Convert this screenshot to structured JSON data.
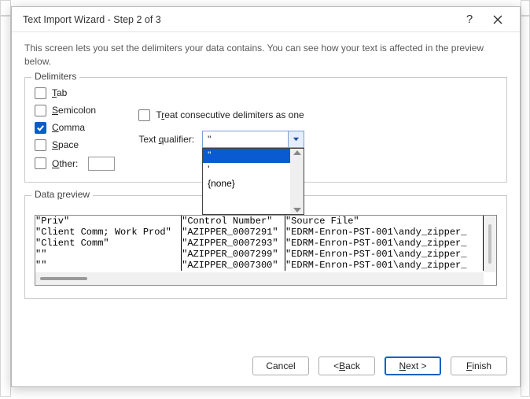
{
  "window": {
    "title": "Text Import Wizard - Step 2 of 3"
  },
  "description": "This screen lets you set the delimiters your data contains.  You can see how your text is affected in the preview below.",
  "delimiters": {
    "legend": "Delimiters",
    "tab": {
      "mnem": "T",
      "rest": "ab",
      "checked": false
    },
    "semicolon": {
      "mnem": "S",
      "rest": "emicolon",
      "checked": false
    },
    "comma": {
      "mnem": "C",
      "rest": "omma",
      "checked": true
    },
    "space": {
      "mnem": "S",
      "rest": "pace",
      "checked": false
    },
    "other": {
      "mnem": "O",
      "rest": "ther:",
      "checked": false,
      "value": ""
    }
  },
  "consecutive": {
    "pre": "T",
    "mnem": "r",
    "rest": "eat consecutive delimiters as one",
    "checked": false
  },
  "qualifier": {
    "label_pre": "Text ",
    "label_mnem": "q",
    "label_rest": "ualifier:",
    "value": "\"",
    "options": [
      "\"",
      "'",
      "{none}"
    ],
    "selected_index": 0
  },
  "preview": {
    "legend_pre": "Data ",
    "legend_mnem": "p",
    "legend_rest": "review",
    "rows": [
      [
        "\"Priv\"",
        "\"Control Number\"",
        "\"Source File\""
      ],
      [
        "\"Client Comm; Work Prod\"",
        "\"AZIPPER_0007291\"",
        "\"EDRM-Enron-PST-001\\andy_zipper_"
      ],
      [
        "\"Client Comm\"",
        "\"AZIPPER_0007293\"",
        "\"EDRM-Enron-PST-001\\andy_zipper_"
      ],
      [
        "\"\"",
        "\"AZIPPER_0007299\"",
        "\"EDRM-Enron-PST-001\\andy_zipper_"
      ],
      [
        "\"\"",
        "\"AZIPPER_0007300\"",
        "\"EDRM-Enron-PST-001\\andy_zipper_"
      ]
    ]
  },
  "buttons": {
    "cancel": "Cancel",
    "back_pre": "< ",
    "back_mnem": "B",
    "back_rest": "ack",
    "next_mnem": "N",
    "next_rest": "ext >",
    "finish_mnem": "F",
    "finish_rest": "inish"
  }
}
